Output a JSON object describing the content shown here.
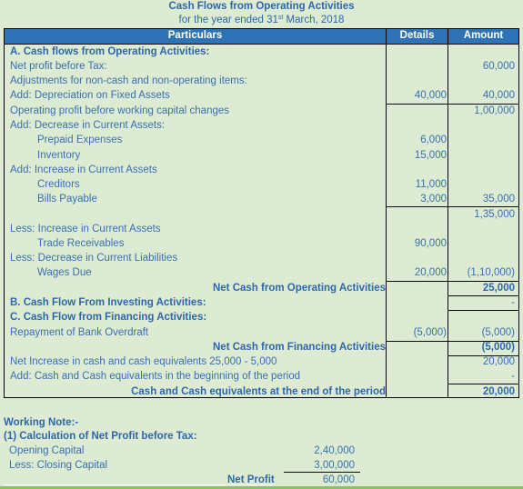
{
  "title": {
    "line1": "Cash Flows from Operating Activities",
    "line2_prefix": "for the year ended 31",
    "line2_sup": "st",
    "line2_suffix": " March, 2018"
  },
  "table": {
    "headers": {
      "particulars": "Particulars",
      "details": "Details",
      "amount": "Amount"
    },
    "rows": [
      {
        "label": "A. Cash flows from Operating Activities:",
        "details": "",
        "amount": ""
      },
      {
        "label": "Net profit before Tax:",
        "details": "",
        "amount": "60,000"
      },
      {
        "label": "Adjustments for non-cash and non-operating items:",
        "details": "",
        "amount": ""
      },
      {
        "label": "Add: Depreciation on Fixed Assets",
        "details": "40,000",
        "amount": "40,000"
      },
      {
        "label": "Operating profit before working capital changes",
        "details": "",
        "amount": "1,00,000"
      },
      {
        "label": "Add: Decrease in Current Assets:",
        "details": "",
        "amount": ""
      },
      {
        "label": "Prepaid Expenses",
        "details": "6,000",
        "amount": ""
      },
      {
        "label": "Inventory",
        "details": "15,000",
        "amount": ""
      },
      {
        "label": "Add: Increase in Current Assets",
        "details": "",
        "amount": ""
      },
      {
        "label": "Creditors",
        "details": "11,000",
        "amount": ""
      },
      {
        "label": "Bills Payable",
        "details": "3,000",
        "amount": "35,000"
      },
      {
        "label": "",
        "details": "",
        "amount": "1,35,000"
      },
      {
        "label": "Less: Increase in Current Assets",
        "details": "",
        "amount": ""
      },
      {
        "label": "Trade Receivables",
        "details": "90,000",
        "amount": ""
      },
      {
        "label": "Less: Decrease in Current Liabilities",
        "details": "",
        "amount": ""
      },
      {
        "label": "Wages Due",
        "details": "20,000",
        "amount": "(1,10,000)"
      },
      {
        "label": "Net Cash from Operating Activities",
        "details": "",
        "amount": "25,000"
      },
      {
        "label": "B. Cash Flow From Investing Activities:",
        "details": "",
        "amount": "-"
      },
      {
        "label": "C. Cash Flow from Financing  Activities:",
        "details": "",
        "amount": ""
      },
      {
        "label": "Repayment of Bank Overdraft",
        "details": "(5,000)",
        "amount": "(5,000)"
      },
      {
        "label": "Net Cash from Financing  Activities",
        "details": "",
        "amount": "(5,000)"
      },
      {
        "label": "Net Increase in cash and cash equivalents  25,000 - 5,000",
        "details": "",
        "amount": "20,000"
      },
      {
        "label": "Add: Cash and Cash equivalents in the beginning of the period",
        "details": "",
        "amount": "-"
      },
      {
        "label": "Cash and Cash equivalents at the end of the period",
        "details": "",
        "amount": "20,000"
      }
    ]
  },
  "working_note": {
    "heading": "Working Note:-",
    "subheading": "(1) Calculation of Net Profit before Tax:",
    "opening_label": "Opening Capital",
    "opening_value": "2,40,000",
    "closing_label": "Less: Closing Capital",
    "closing_value": "3,00,000",
    "net_label": "Net Profit",
    "net_value": "60,000"
  }
}
